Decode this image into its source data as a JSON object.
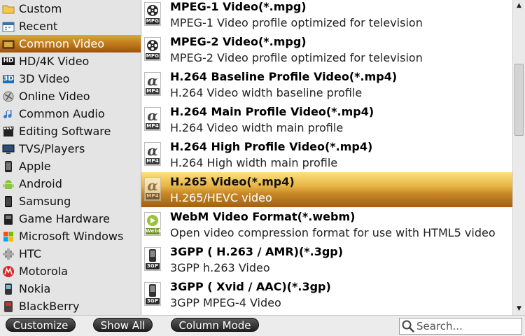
{
  "categories": [
    {
      "label": "Custom",
      "icon": "folder-icon"
    },
    {
      "label": "Recent",
      "icon": "calendar-icon"
    },
    {
      "label": "Common Video",
      "icon": "film-icon",
      "selected": true
    },
    {
      "label": "HD/4K Video",
      "icon": "hd-icon"
    },
    {
      "label": "3D Video",
      "icon": "3d-icon"
    },
    {
      "label": "Online Video",
      "icon": "globe-icon"
    },
    {
      "label": "Common Audio",
      "icon": "music-note-icon"
    },
    {
      "label": "Editing Software",
      "icon": "clapperboard-icon"
    },
    {
      "label": "TVS/Players",
      "icon": "tv-icon"
    },
    {
      "label": "Apple",
      "icon": "phone-icon"
    },
    {
      "label": "Android",
      "icon": "android-icon"
    },
    {
      "label": "Samsung",
      "icon": "samsung-phone-icon"
    },
    {
      "label": "Game Hardware",
      "icon": "game-console-icon"
    },
    {
      "label": "Microsoft Windows",
      "icon": "windows-logo-icon"
    },
    {
      "label": "HTC",
      "icon": "htc-icon"
    },
    {
      "label": "Motorola",
      "icon": "motorola-logo-icon"
    },
    {
      "label": "Nokia",
      "icon": "nokia-phone-icon"
    },
    {
      "label": "BlackBerry",
      "icon": "blackberry-icon"
    }
  ],
  "formats": [
    {
      "title": "MPEG-1 Video(*.mpg)",
      "desc": "MPEG-1 Video profile optimized for television",
      "icon": "film-reel-icon",
      "tag": "MPG"
    },
    {
      "title": "MPEG-2 Video(*.mpg)",
      "desc": "MPEG-2 Video profile optimized for television",
      "icon": "film-reel-icon",
      "tag": "MPG"
    },
    {
      "title": "H.264 Baseline Profile Video(*.mp4)",
      "desc": "H.264 Video width baseline profile",
      "icon": "alpha-icon",
      "tag": "MP4"
    },
    {
      "title": "H.264 Main Profile Video(*.mp4)",
      "desc": "H.264 Video width main profile",
      "icon": "alpha-icon",
      "tag": "MP4"
    },
    {
      "title": "H.264 High Profile Video(*.mp4)",
      "desc": "H.264 High width main profile",
      "icon": "alpha-icon",
      "tag": "MP4"
    },
    {
      "title": "H.265 Video(*.mp4)",
      "desc": "H.265/HEVC video",
      "icon": "alpha-icon",
      "tag": "MP4",
      "selected": true
    },
    {
      "title": "WebM Video Format(*.webm)",
      "desc": "Open video compression format for use with HTML5 video",
      "icon": "webm-play-icon",
      "tag": "WebM"
    },
    {
      "title": "3GPP ( H.263 / AMR)(*.3gp)",
      "desc": "3GPP h.263 Video",
      "icon": "phone-3gp-icon",
      "tag": "3GP"
    },
    {
      "title": "3GPP ( Xvid / AAC)(*.3gp)",
      "desc": "3GPP MPEG-4 Video",
      "icon": "phone-3gp-icon",
      "tag": "3GP"
    }
  ],
  "toolbar": {
    "customize_label": "Customize",
    "show_all_label": "Show All",
    "column_mode_label": "Column Mode",
    "search_placeholder": "Search..."
  },
  "colors": {
    "selection_top": "#d9a73e",
    "selection_bottom": "#9c5310",
    "button_dark": "#1f1f1f"
  }
}
